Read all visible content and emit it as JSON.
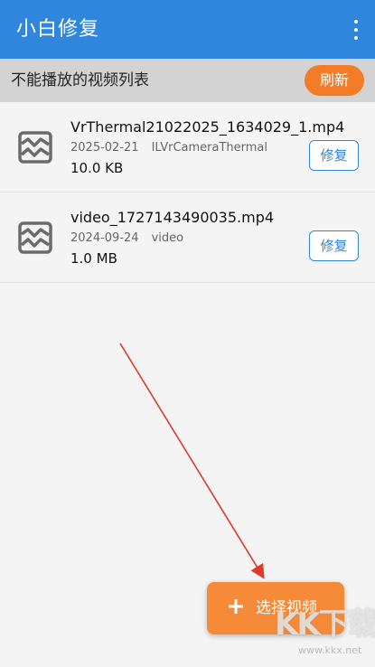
{
  "appbar": {
    "title": "小白修复",
    "menu_icon": "more-vertical-icon",
    "background": "#2f86dc"
  },
  "subheader": {
    "label": "不能播放的视频列表",
    "refresh_label": "刷新",
    "refresh_color": "#f47c26"
  },
  "videos": [
    {
      "name": "VrThermal21022025_1634029_1.mp4",
      "date": "2025-02-21",
      "folder": "ILVrCameraThermal",
      "size": "10.0 KB",
      "repair_label": "修复",
      "icon": "broken-image-icon"
    },
    {
      "name": "video_1727143490035.mp4",
      "date": "2024-09-24",
      "folder": "video",
      "size": "1.0 MB",
      "repair_label": "修复",
      "icon": "broken-image-icon"
    }
  ],
  "fab": {
    "label": "选择视频",
    "icon": "plus-icon",
    "color": "#f58a38"
  },
  "watermark": {
    "text": "KK下载",
    "url": "www.kkx.net"
  }
}
